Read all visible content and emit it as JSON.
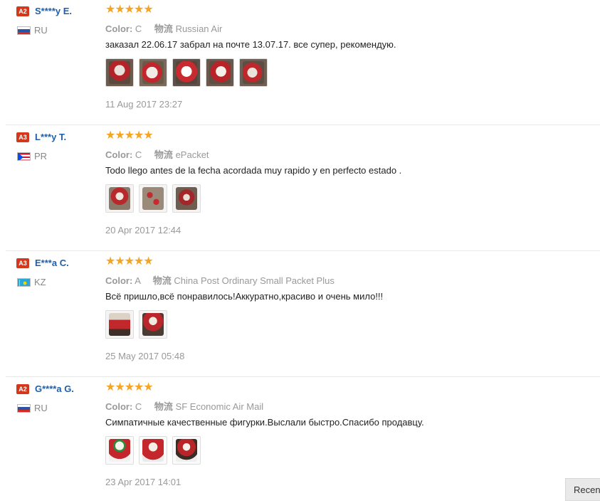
{
  "reviews": [
    {
      "badge": "A2",
      "user": "S****y E.",
      "country": "RU",
      "flag": "ru",
      "stars": "★★★★★",
      "color_label": "Color:",
      "color_value": "C",
      "shipping_label": "物流",
      "shipping_value": "Russian Air",
      "text": "заказал 22.06.17 забрал на почте 13.07.17. все супер, рекомендую.",
      "date": "11 Aug 2017 23:27"
    },
    {
      "badge": "A3",
      "user": "L***y T.",
      "country": "PR",
      "flag": "pr",
      "stars": "★★★★★",
      "color_label": "Color:",
      "color_value": "C",
      "shipping_label": "物流",
      "shipping_value": "ePacket",
      "text": "Todo llego antes de la fecha acordada muy rapido y en perfecto estado .",
      "date": "20 Apr 2017 12:44"
    },
    {
      "badge": "A3",
      "user": "E***a C.",
      "country": "KZ",
      "flag": "kz",
      "stars": "★★★★★",
      "color_label": "Color:",
      "color_value": "A",
      "shipping_label": "物流",
      "shipping_value": "China Post Ordinary Small Packet Plus",
      "text": "Всё пришло,всё понравилось!Аккуратно,красиво и очень мило!!!",
      "date": "25 May 2017 05:48"
    },
    {
      "badge": "A2",
      "user": "G****a G.",
      "country": "RU",
      "flag": "ru",
      "stars": "★★★★★",
      "color_label": "Color:",
      "color_value": "C",
      "shipping_label": "物流",
      "shipping_value": "SF Economic Air Mail",
      "text": "Симпатичные качественные фигурки.Выслали быстро.Спасибо продавцу.",
      "date": "23 Apr 2017 14:01"
    }
  ],
  "tab_button": "Recent",
  "colors": {
    "badge": "#d4381c",
    "username": "#1f5ea8",
    "stars": "#f5a524",
    "muted": "#999999"
  }
}
